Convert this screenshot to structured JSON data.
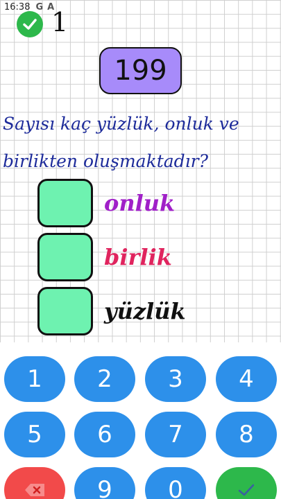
{
  "status_bar": {
    "time": "16:38",
    "icons": [
      "G",
      "A"
    ]
  },
  "header": {
    "score": "1"
  },
  "problem": {
    "number": "199",
    "question_line1": "Sayısı kaç yüzlük, onluk ve",
    "question_line2": "birlikten oluşmaktadır?"
  },
  "answers": [
    {
      "label": "onluk",
      "color": "#a020c8",
      "value": ""
    },
    {
      "label": "birlik",
      "color": "#e0245e",
      "value": ""
    },
    {
      "label": "yüzlük",
      "color": "#111111",
      "value": ""
    }
  ],
  "keypad": {
    "keys": [
      "1",
      "2",
      "3",
      "4",
      "5",
      "6",
      "7",
      "8",
      "9",
      "0"
    ],
    "delete_icon": "backspace-icon",
    "confirm_icon": "check-icon"
  }
}
